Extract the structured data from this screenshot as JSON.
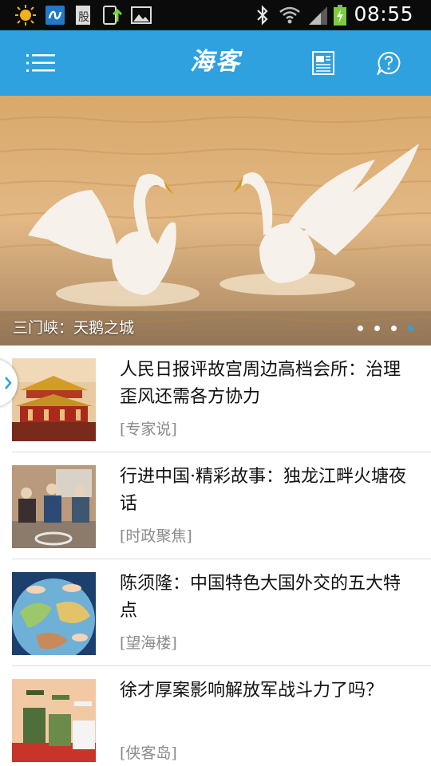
{
  "status_bar": {
    "time": "08:55",
    "icons": [
      "weather-sun-icon",
      "app-notification-icon",
      "stock-icon",
      "download-icon",
      "gallery-icon",
      "bluetooth-icon",
      "wifi-icon",
      "signal-icon",
      "battery-charging-icon"
    ]
  },
  "header": {
    "title": "海客",
    "menu_icon": "menu-icon",
    "news_icon": "newspaper-icon",
    "help_icon": "help-icon",
    "color": "#2fa1df"
  },
  "banner": {
    "caption": "三门峡：天鹅之城",
    "slides": 4,
    "active_slide": 4
  },
  "news": [
    {
      "title": "人民日报评故宫周边高档会所：治理歪风还需各方协力",
      "tag": "[专家说]"
    },
    {
      "title": "行进中国·精彩故事：独龙江畔火塘夜话",
      "tag": "[时政聚焦]"
    },
    {
      "title": "陈须隆：中国特色大国外交的五大特点",
      "tag": "[望海楼]"
    },
    {
      "title": "徐才厚案影响解放军战斗力了吗？",
      "tag": "[侠客岛]"
    }
  ]
}
